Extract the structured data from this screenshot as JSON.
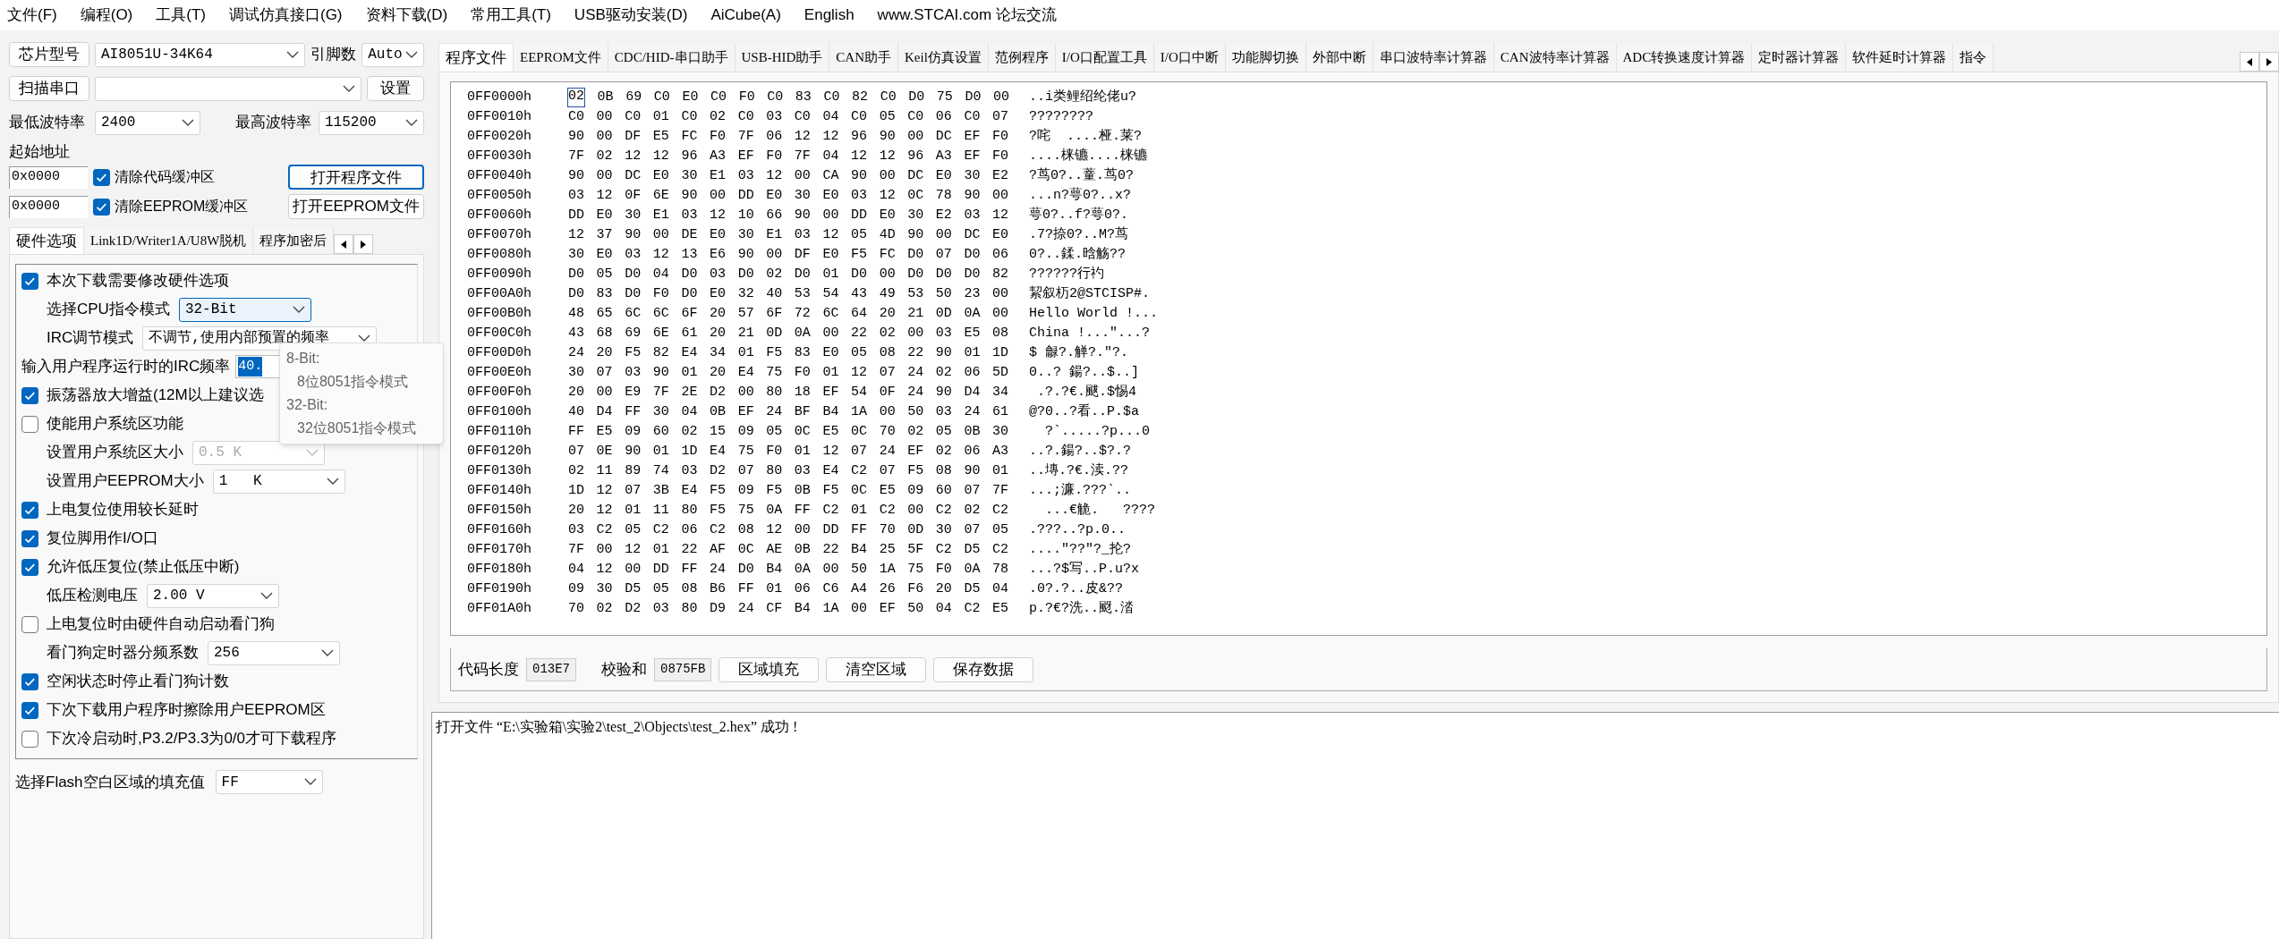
{
  "menu": [
    "文件(F)",
    "编程(O)",
    "工具(T)",
    "调试仿真接口(G)",
    "资料下载(D)",
    "常用工具(T)",
    "USB驱动安装(D)",
    "AiCube(A)",
    "English",
    "www.STCAI.com 论坛交流"
  ],
  "chip": {
    "button": "芯片型号",
    "value": "AI8051U-34K64",
    "pins_label": "引脚数",
    "pins_value": "Auto"
  },
  "port": {
    "button": "扫描串口",
    "settings_button": "设置"
  },
  "baud": {
    "min_label": "最低波特率",
    "min_value": "2400",
    "max_label": "最高波特率",
    "max_value": "115200"
  },
  "start_address": {
    "label": "起始地址",
    "rows": [
      {
        "value": "0x0000",
        "checkbox": "清除代码缓冲区",
        "checked": true,
        "button": "打开程序文件",
        "focused": true
      },
      {
        "value": "0x0000",
        "checkbox": "清除EEPROM缓冲区",
        "checked": true,
        "button": "打开EEPROM文件",
        "focused": false
      }
    ]
  },
  "left_tabs": [
    {
      "label": "硬件选项",
      "selected": true
    },
    {
      "label": "Link1D/Writer1A/U8W脱机",
      "selected": false
    },
    {
      "label": "程序加密后",
      "selected": false
    }
  ],
  "options": [
    {
      "kind": "checkbox",
      "label": "本次下载需要修改硬件选项",
      "checked": true
    },
    {
      "kind": "select",
      "label": "选择CPU指令模式",
      "value": "32-Bit",
      "disabled": false,
      "focused": true
    },
    {
      "kind": "select",
      "label": "IRC调节模式",
      "value": "不调节,使用内部预置的频率",
      "disabled": false,
      "focused": false
    },
    {
      "kind": "input",
      "label": "输入用户程序运行时的IRC频率",
      "value": "40."
    },
    {
      "kind": "checkbox",
      "label": "振荡器放大增益(12M以上建议选",
      "checked": true
    },
    {
      "kind": "checkbox",
      "label": "使能用户系统区功能",
      "checked": false
    },
    {
      "kind": "select",
      "label": "设置用户系统区大小",
      "value": "0.5 K",
      "disabled": true,
      "focused": false
    },
    {
      "kind": "select",
      "label": "设置用户EEPROM大小",
      "value": "1   K",
      "disabled": false,
      "focused": false
    },
    {
      "kind": "checkbox",
      "label": "上电复位使用较长延时",
      "checked": true
    },
    {
      "kind": "checkbox",
      "label": "复位脚用作I/O口",
      "checked": true
    },
    {
      "kind": "checkbox",
      "label": "允许低压复位(禁止低压中断)",
      "checked": true
    },
    {
      "kind": "select",
      "label": "低压检测电压",
      "value": "2.00 V",
      "disabled": false,
      "focused": false
    },
    {
      "kind": "checkbox",
      "label": "上电复位时由硬件自动启动看门狗",
      "checked": false
    },
    {
      "kind": "select",
      "label": "看门狗定时器分频系数",
      "value": "256",
      "disabled": false,
      "focused": false
    },
    {
      "kind": "checkbox",
      "label": "空闲状态时停止看门狗计数",
      "checked": true
    },
    {
      "kind": "checkbox",
      "label": "下次下载用户程序时擦除用户EEPROM区",
      "checked": true
    },
    {
      "kind": "checkbox",
      "label": "下次冷启动时,P3.2/P3.3为0/0才可下载程序",
      "checked": false
    }
  ],
  "fill": {
    "label": "选择Flash空白区域的填充值",
    "value": "FF"
  },
  "tooltip": [
    "8-Bit:",
    "8位8051指令模式",
    "32-Bit:",
    "32位8051指令模式"
  ],
  "main_tabs": [
    {
      "label": "程序文件",
      "selected": true
    },
    {
      "label": "EEPROM文件",
      "selected": false
    },
    {
      "label": "CDC/HID-串口助手",
      "selected": false
    },
    {
      "label": "USB-HID助手",
      "selected": false
    },
    {
      "label": "CAN助手",
      "selected": false
    },
    {
      "label": "Keil仿真设置",
      "selected": false
    },
    {
      "label": "范例程序",
      "selected": false
    },
    {
      "label": "I/O口配置工具",
      "selected": false
    },
    {
      "label": "I/O口中断",
      "selected": false
    },
    {
      "label": "功能脚切换",
      "selected": false
    },
    {
      "label": "外部中断",
      "selected": false
    },
    {
      "label": "串口波特率计算器",
      "selected": false
    },
    {
      "label": "CAN波特率计算器",
      "selected": false
    },
    {
      "label": "ADC转换速度计算器",
      "selected": false
    },
    {
      "label": "定时器计算器",
      "selected": false
    },
    {
      "label": "软件延时计算器",
      "selected": false
    },
    {
      "label": "指令",
      "selected": false
    }
  ],
  "hex_rows": [
    {
      "address": "0FF0000h",
      "bytes": "02 0B 69 C0 E0 C0 F0 C0 83 C0 82 C0 D0 75 D0 00",
      "ascii": "..i类鲤绍纶佬u?",
      "cursor": true
    },
    {
      "address": "0FF0010h",
      "bytes": "C0 00 C0 01 C0 02 C0 03 C0 04 C0 05 C0 06 C0 07",
      "ascii": "????????",
      "cursor": false
    },
    {
      "address": "0FF0020h",
      "bytes": "90 00 DF E5 FC F0 7F 06 12 12 96 90 00 DC EF F0",
      "ascii": "?咤  ....桠.莱?",
      "cursor": false
    },
    {
      "address": "0FF0030h",
      "bytes": "7F 02 12 12 96 A3 EF F0 7F 04 12 12 96 A3 EF F0",
      "ascii": "....梾镳....梾镳",
      "cursor": false
    },
    {
      "address": "0FF0040h",
      "bytes": "90 00 DC E0 30 E1 03 12 00 CA 90 00 DC E0 30 E2",
      "ascii": "?茑0?..蕫.茑0?",
      "cursor": false
    },
    {
      "address": "0FF0050h",
      "bytes": "03 12 0F 6E 90 00 DD E0 30 E0 03 12 0C 78 90 00",
      "ascii": "...n?萼0?..x?",
      "cursor": false
    },
    {
      "address": "0FF0060h",
      "bytes": "DD E0 30 E1 03 12 10 66 90 00 DD E0 30 E2 03 12",
      "ascii": "萼0?..f?萼0?.",
      "cursor": false
    },
    {
      "address": "0FF0070h",
      "bytes": "12 37 90 00 DE E0 30 E1 03 12 05 4D 90 00 DC E0",
      "ascii": ".7?捺0?..M?茑",
      "cursor": false
    },
    {
      "address": "0FF0080h",
      "bytes": "30 E0 03 12 13 E6 90 00 DF E0 F5 FC D0 07 D0 06",
      "ascii": "0?..鍒.晗觞??",
      "cursor": false
    },
    {
      "address": "0FF0090h",
      "bytes": "D0 05 D0 04 D0 03 D0 02 D0 01 D0 00 D0 D0 D0 82",
      "ascii": "??????行礿",
      "cursor": false
    },
    {
      "address": "0FF00A0h",
      "bytes": "D0 83 D0 F0 D0 E0 32 40 53 54 43 49 53 50 23 00",
      "ascii": "絜叙杤2@STCISP#.",
      "cursor": false
    },
    {
      "address": "0FF00B0h",
      "bytes": "48 65 6C 6C 6F 20 57 6F 72 6C 64 20 21 0D 0A 00",
      "ascii": "Hello World !...",
      "cursor": false
    },
    {
      "address": "0FF00C0h",
      "bytes": "43 68 69 6E 61 20 21 0D 0A 00 22 02 00 03 E5 08",
      "ascii": "China !...\"...?",
      "cursor": false
    },
    {
      "address": "0FF00D0h",
      "bytes": "24 20 F5 82 E4 34 01 F5 83 E0 05 08 22 90 01 1D",
      "ascii": "$ 龣?.觯?.\"?.",
      "cursor": false
    },
    {
      "address": "0FF00E0h",
      "bytes": "30 07 03 90 01 20 E4 75 F0 01 12 07 24 02 06 5D",
      "ascii": "0..? 鍚?..$..]",
      "cursor": false
    },
    {
      "address": "0FF00F0h",
      "bytes": "20 00 E9 7F 2E D2 00 80 18 EF 54 0F 24 90 D4 34",
      "ascii": " .?.?€.颰.$惕4",
      "cursor": false
    },
    {
      "address": "0FF0100h",
      "bytes": "40 D4 FF 30 04 0B EF 24 BF B4 1A 00 50 03 24 61",
      "ascii": "@?0..?看..P.$a",
      "cursor": false
    },
    {
      "address": "0FF0110h",
      "bytes": "FF E5 09 60 02 15 09 05 0C E5 0C 70 02 05 0B 30",
      "ascii": "  ?`.....?p...0",
      "cursor": false
    },
    {
      "address": "0FF0120h",
      "bytes": "07 0E 90 01 1D E4 75 F0 01 12 07 24 EF 02 06 A3",
      "ascii": "..?.鍚?..$?.?",
      "cursor": false
    },
    {
      "address": "0FF0130h",
      "bytes": "02 11 89 74 03 D2 07 80 03 E4 C2 07 F5 08 90 01",
      "ascii": "..塼.?€.渎.??",
      "cursor": false
    },
    {
      "address": "0FF0140h",
      "bytes": "1D 12 07 3B E4 F5 09 F5 0B F5 0C E5 09 60 07 7F",
      "ascii": "...;濂.???`..",
      "cursor": false
    },
    {
      "address": "0FF0150h",
      "bytes": "20 12 01 11 80 F5 75 0A FF C2 01 C2 00 C2 02 C2",
      "ascii": "  ...€觤.   ????",
      "cursor": false
    },
    {
      "address": "0FF0160h",
      "bytes": "03 C2 05 C2 06 C2 08 12 00 DD FF 70 0D 30 07 05",
      "ascii": ".???..?p.0..",
      "cursor": false
    },
    {
      "address": "0FF0170h",
      "bytes": "7F 00 12 01 22 AF 0C AE 0B 22 B4 25 5F C2 D5 C2",
      "ascii": "....\"??\"?_抡?",
      "cursor": false
    },
    {
      "address": "0FF0180h",
      "bytes": "04 12 00 DD FF 24 D0 B4 0A 00 50 1A 75 F0 0A 78",
      "ascii": "...?$写..P.u?x",
      "cursor": false
    },
    {
      "address": "0FF0190h",
      "bytes": "09 30 D5 05 08 B6 FF 01 06 C6 A4 26 F6 20 D5 04",
      "ascii": ".0?.?..皮&??",
      "cursor": false
    },
    {
      "address": "0FF01A0h",
      "bytes": "70 02 D2 03 80 D9 24 CF B4 1A 00 EF 50 04 C2 E5",
      "ascii": "p.?€?洗..颬.涾",
      "cursor": false
    }
  ],
  "footer": {
    "length_label": "代码长度",
    "length_value": "013E7",
    "checksum_label": "校验和",
    "checksum_value": "0875FB",
    "buttons": [
      "区域填充",
      "清空区域",
      "保存数据"
    ]
  },
  "log": "打开文件 “E:\\实验箱\\实验2\\test_2\\Objects\\test_2.hex” 成功 !"
}
